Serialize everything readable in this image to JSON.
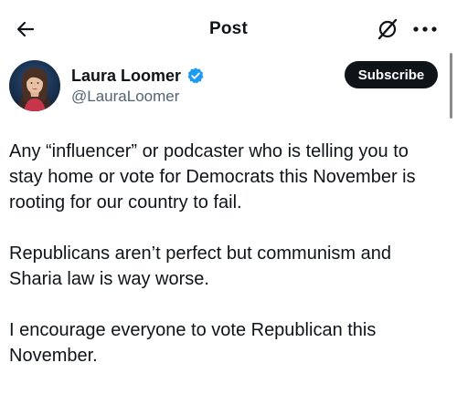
{
  "header": {
    "title": "Post",
    "back_icon": "arrow-left-icon",
    "grok_icon": "grok-icon",
    "more_icon": "more-horizontal-icon"
  },
  "author": {
    "name": "Laura Loomer",
    "handle": "@LauraLoomer",
    "verified": true,
    "verified_color": "#1d9bf0"
  },
  "actions": {
    "subscribe_label": "Subscribe"
  },
  "tweet": {
    "paragraphs": [
      "Any “influencer” or podcaster who is telling you to stay home or vote for Democrats this November is rooting for our country to fail.",
      "Republicans aren’t perfect but communism and Sharia law is way worse.",
      "I encourage everyone to vote Republican this November."
    ]
  },
  "colors": {
    "text": "#0f1419",
    "secondary_text": "#536471",
    "button_bg": "#0f1419",
    "button_text": "#ffffff"
  }
}
